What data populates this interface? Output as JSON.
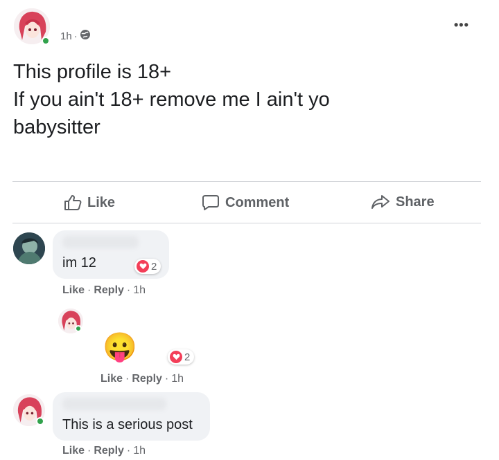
{
  "post": {
    "time": "1h",
    "separator": "·",
    "text": "This profile is 18+\nIf you ain't 18+ remove me I ain't yo\nbabysitter"
  },
  "actions": {
    "like": "Like",
    "comment": "Comment",
    "share": "Share"
  },
  "comments": [
    {
      "text": "im 12",
      "reaction_count": "2",
      "like": "Like",
      "reply": "Reply",
      "time": "1h"
    },
    {
      "text": "😛",
      "reaction_count": "2",
      "like": "Like",
      "reply": "Reply",
      "time": "1h"
    },
    {
      "text": "This is a serious post",
      "like": "Like",
      "reply": "Reply",
      "time": "1h"
    }
  ],
  "colors": {
    "online": "#31a24c",
    "heart": "#f33e58",
    "bubble": "#f0f2f5",
    "muted": "#65676b"
  },
  "icons": {
    "audience": "globe-icon",
    "more": "more-options-icon",
    "like": "thumbs-up-icon",
    "comment": "speech-bubble-icon",
    "share": "share-arrow-icon",
    "reaction": "heart-reaction-icon"
  }
}
